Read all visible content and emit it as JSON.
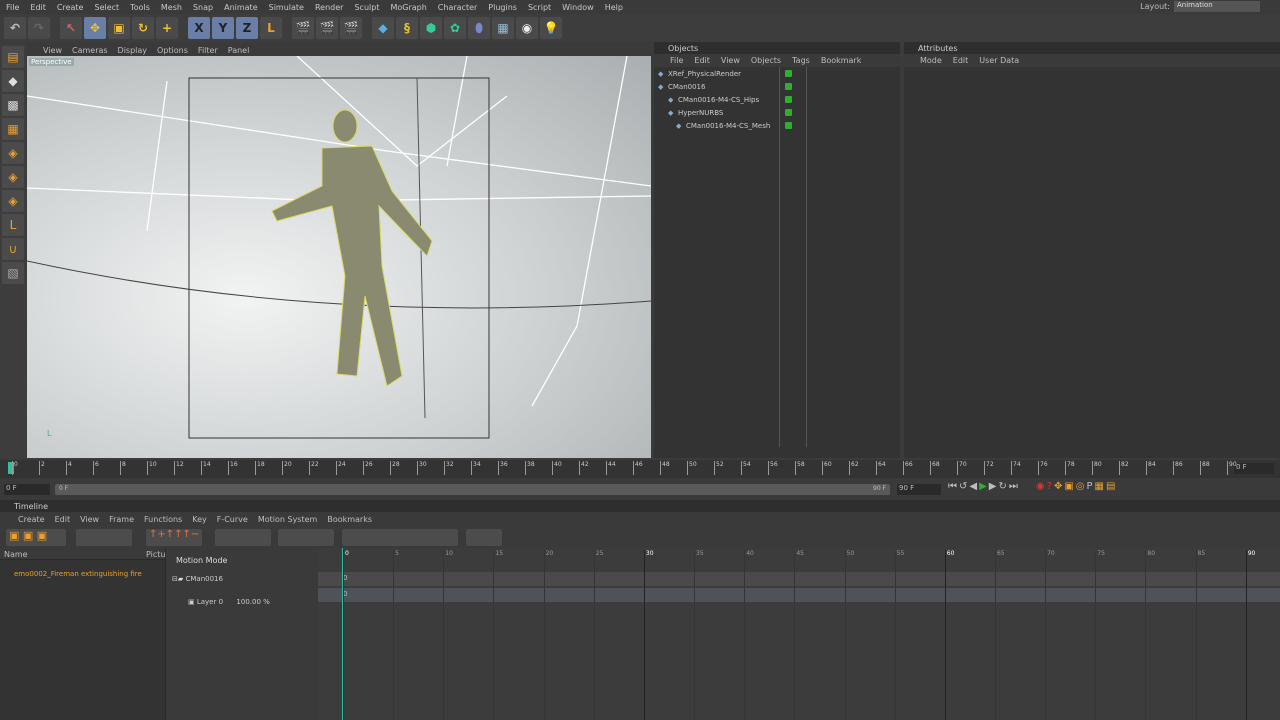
{
  "menu": [
    "File",
    "Edit",
    "Create",
    "Select",
    "Tools",
    "Mesh",
    "Snap",
    "Animate",
    "Simulate",
    "Render",
    "Sculpt",
    "MoGraph",
    "Character",
    "Plugins",
    "Script",
    "Window",
    "Help"
  ],
  "layout": {
    "label": "Layout:",
    "value": "Animation"
  },
  "viewport": {
    "menu": [
      "View",
      "Cameras",
      "Display",
      "Options",
      "Filter",
      "Panel"
    ],
    "camera": "Perspective"
  },
  "objects": {
    "title": "Objects",
    "menu": [
      "File",
      "Edit",
      "View",
      "Objects",
      "Tags",
      "Bookmark"
    ],
    "items": [
      "XRef_PhysicalRender",
      "CMan0016",
      "CMan0016-M4-CS_Hips",
      "HyperNURBS",
      "CMan0016-M4-CS_Mesh"
    ]
  },
  "attributes": {
    "title": "Attributes",
    "menu": [
      "Mode",
      "Edit",
      "User Data"
    ]
  },
  "ruler": {
    "start": 0,
    "end": 90,
    "step": 2,
    "current_frame": "0 F"
  },
  "range": {
    "start": "0 F",
    "end": "90 F",
    "max": "90 F",
    "left_val": "0 F"
  },
  "timeline": {
    "title": "Timeline",
    "menu": [
      "Create",
      "Edit",
      "View",
      "Frame",
      "Functions",
      "Key",
      "F-Curve",
      "Motion System",
      "Bookmarks"
    ],
    "col_name": "Name",
    "col_picture": "Pictur",
    "motion_mode": "Motion Mode",
    "clip": "emo0002_Fireman extinguishing fire",
    "tracks": [
      {
        "name": "CMan0016",
        "value": "0"
      },
      {
        "name": "Layer 0",
        "weight": "100.00 %",
        "value": "0"
      }
    ],
    "ruler": {
      "start": 0,
      "end": 90,
      "step": 5
    }
  },
  "colors": {
    "accent": "#e8a030",
    "play": "#2fae2f",
    "cursor": "#2fc0a0"
  }
}
